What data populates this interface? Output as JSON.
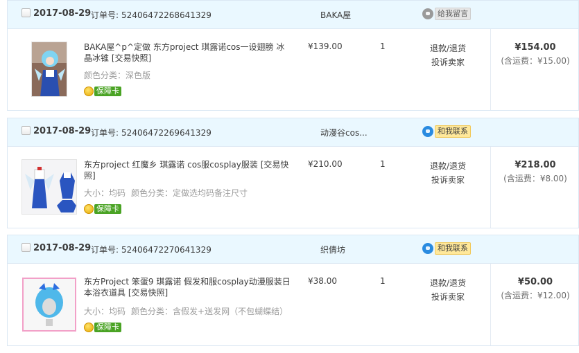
{
  "labels": {
    "order_no": "订单号:",
    "refund": "退款/退货",
    "complain": "投诉卖家",
    "guarantee": "保障卡",
    "snapshot": "[交易快照]"
  },
  "orders": [
    {
      "date": "2017-08-29",
      "order_no": "52406472268641329",
      "shop": "BAKA屋",
      "contact": "给我留言",
      "title": "BAKA屋^p^定做 东方project 琪露诺cos一设翅膀 冰晶冰锥",
      "sku": [
        "颜色分类：深色版"
      ],
      "price": "¥139.00",
      "qty": "1",
      "total": "¥154.00",
      "shipping": "(含运费：¥15.00)"
    },
    {
      "date": "2017-08-29",
      "order_no": "52406472269641329",
      "shop": "动漫谷cos...",
      "contact": "和我联系",
      "title": "东方project 红魔乡 琪露诺 cos服cosplay服装",
      "sku": [
        "大小：均码",
        "颜色分类：定做选均码备注尺寸"
      ],
      "price": "¥210.00",
      "qty": "1",
      "total": "¥218.00",
      "shipping": "(含运费：¥8.00)"
    },
    {
      "date": "2017-08-29",
      "order_no": "52406472270641329",
      "shop": "织倩坊",
      "contact": "和我联系",
      "title": "东方Project 笨蛋9 琪露诺 假发和服cosplay动漫服装日本浴衣道具",
      "sku": [
        "大小：均码",
        "颜色分类：含假发+送发网（不包蝴蝶结）"
      ],
      "price": "¥38.00",
      "qty": "1",
      "total": "¥50.00",
      "shipping": "(含运费：¥12.00)"
    }
  ]
}
